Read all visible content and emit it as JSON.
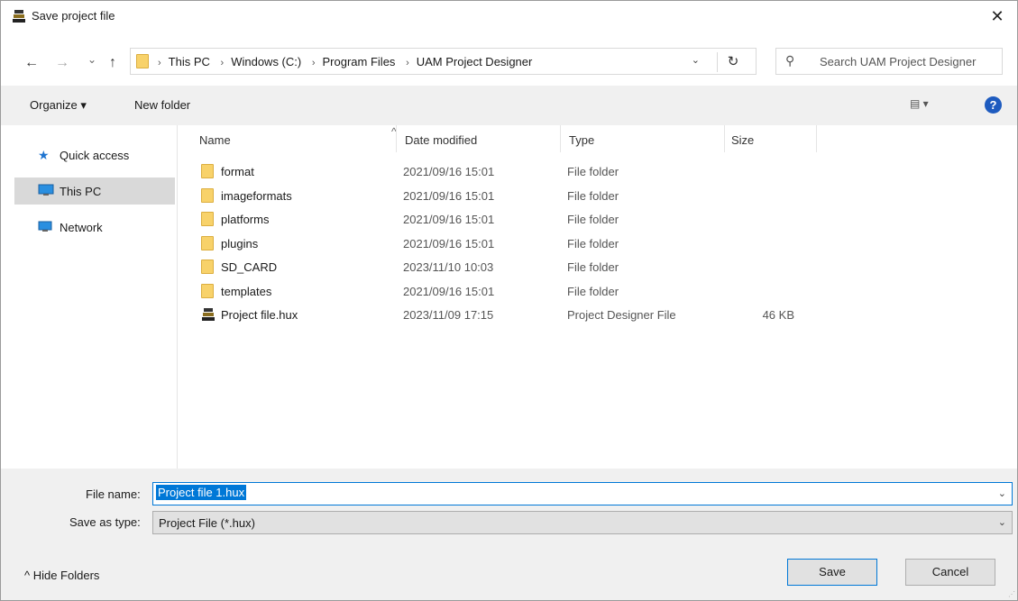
{
  "window": {
    "title": "Save project file",
    "close_label": "✕"
  },
  "nav": {
    "back": "←",
    "forward": "→",
    "recent": "⌄",
    "up": "↑"
  },
  "address": {
    "crumbs": [
      "This PC",
      "Windows (C:)",
      "Program Files",
      "UAM Project Designer"
    ],
    "dropdown": "⌄",
    "refresh": "↻"
  },
  "search": {
    "placeholder": "Search UAM Project Designer"
  },
  "toolbar": {
    "organize_label": "Organize ▾",
    "new_folder_label": "New folder",
    "view_label": "▤ ▾",
    "help_label": "?"
  },
  "sidebar": {
    "items": [
      {
        "label": "Quick access"
      },
      {
        "label": "This PC"
      },
      {
        "label": "Network"
      }
    ]
  },
  "columns": {
    "name": "Name",
    "date": "Date modified",
    "type": "Type",
    "size": "Size",
    "sort_indicator": "^"
  },
  "files": [
    {
      "name": "format",
      "date": "2021/09/16 15:01",
      "type": "File folder",
      "size": ""
    },
    {
      "name": "imageformats",
      "date": "2021/09/16 15:01",
      "type": "File folder",
      "size": ""
    },
    {
      "name": "platforms",
      "date": "2021/09/16 15:01",
      "type": "File folder",
      "size": ""
    },
    {
      "name": "plugins",
      "date": "2021/09/16 15:01",
      "type": "File folder",
      "size": ""
    },
    {
      "name": "SD_CARD",
      "date": "2023/11/10 10:03",
      "type": "File folder",
      "size": ""
    },
    {
      "name": "templates",
      "date": "2021/09/16 15:01",
      "type": "File folder",
      "size": ""
    },
    {
      "name": "Project file.hux",
      "date": "2023/11/09 17:15",
      "type": "Project Designer File",
      "size": "46 KB"
    }
  ],
  "form": {
    "file_name_label": "File name:",
    "file_name_value": "Project file 1.hux",
    "save_type_label": "Save as type:",
    "save_type_value": "Project File (*.hux)"
  },
  "footer": {
    "hide_folders": "^  Hide Folders",
    "save": "Save",
    "cancel": "Cancel"
  }
}
